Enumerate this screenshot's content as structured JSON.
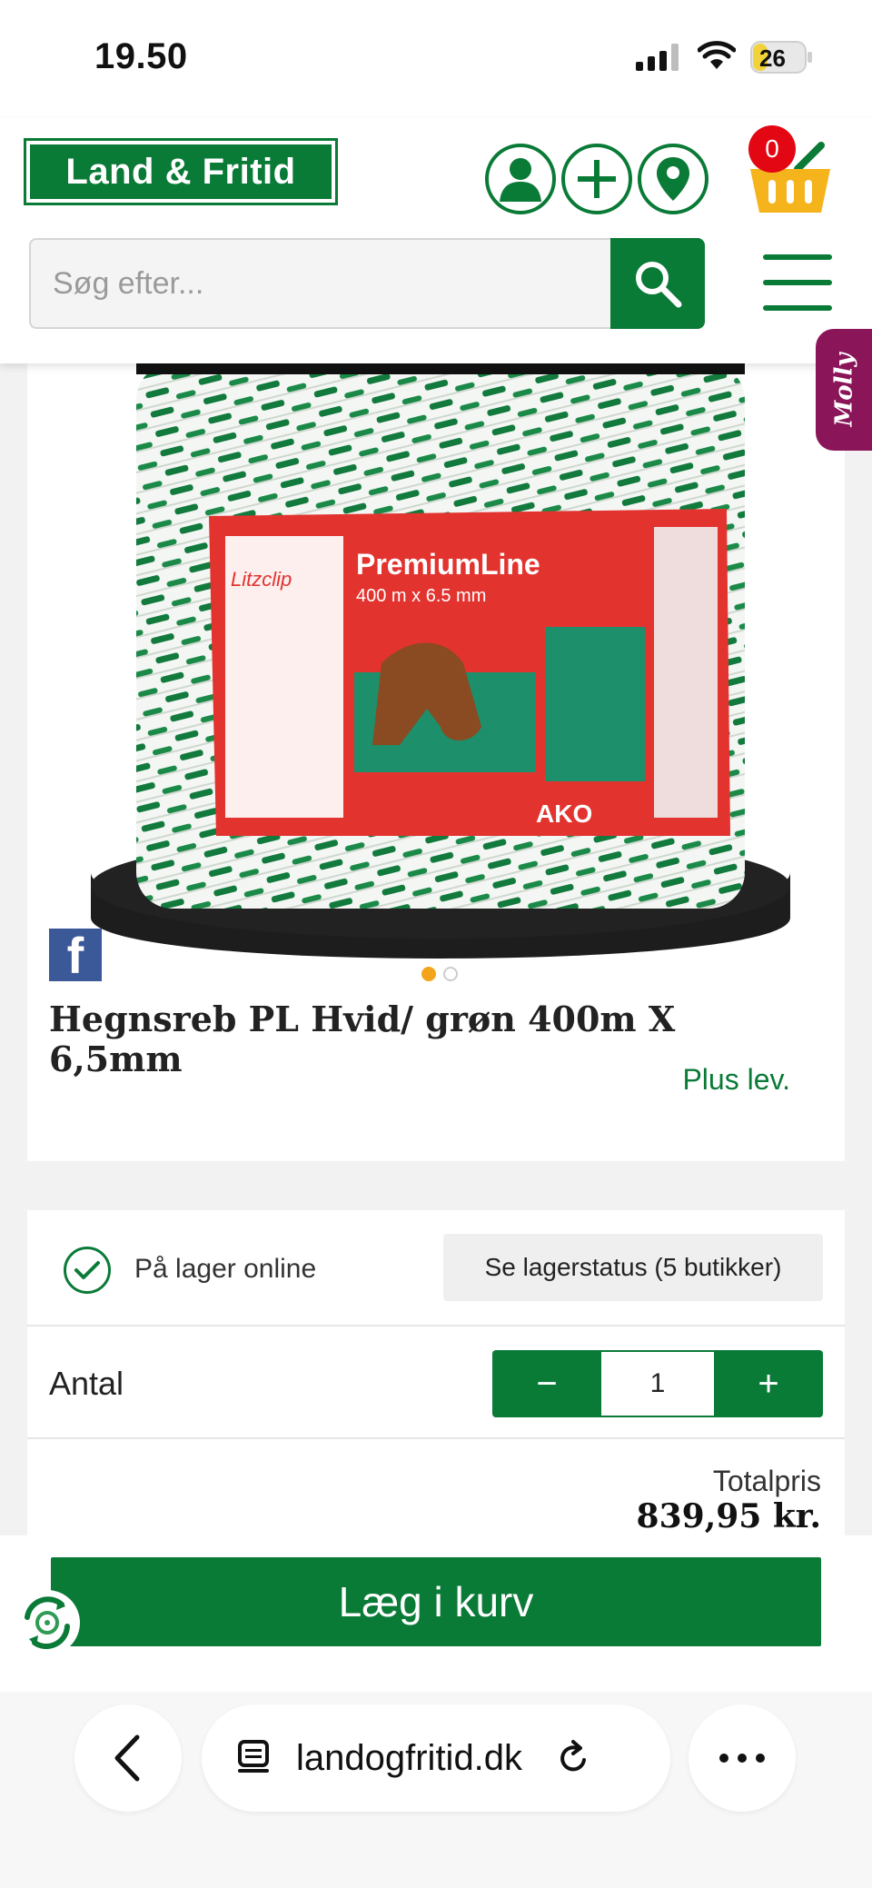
{
  "status_bar": {
    "time": "19.50",
    "battery": "26"
  },
  "header": {
    "logo_text": "Land & Fritid",
    "cart_count": "0",
    "search_placeholder": "Søg efter..."
  },
  "chat": {
    "label": "Molly"
  },
  "product": {
    "title": "Hegnsreb PL Hvid/ grøn 400m X 6,5mm",
    "delivery": "Plus lev.",
    "image": {
      "brand": "PremiumLine",
      "size": "400 m x 6.5 mm",
      "maker": "AKO",
      "clip_label": "Litzclip"
    },
    "carousel": {
      "count": 2,
      "active": 1
    }
  },
  "stock": {
    "status": "På lager online",
    "button": "Se lagerstatus (5 butikker)"
  },
  "quantity": {
    "label": "Antal",
    "value": "1",
    "minus": "−",
    "plus": "+"
  },
  "total": {
    "label": "Totalpris",
    "value": "839,95 kr."
  },
  "cart_button": "Læg i kurv",
  "browser": {
    "url": "landogfritid.dk"
  },
  "colors": {
    "brand_green": "#0a7a37",
    "badge_red": "#e30613",
    "chat_purple": "#8a1559",
    "dot_active": "#f4a41a"
  }
}
